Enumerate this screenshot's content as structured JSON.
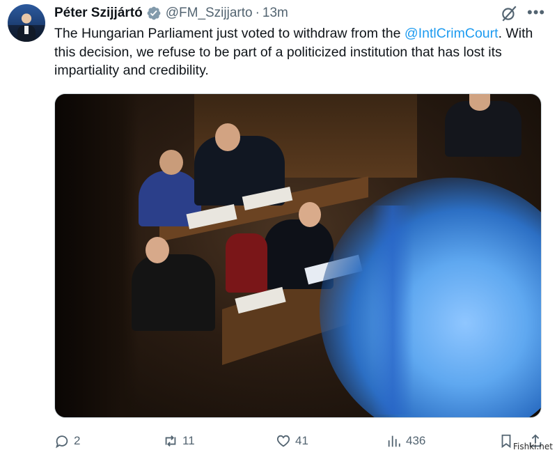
{
  "author": {
    "name": "Péter Szijjártó",
    "handle": "@FM_Szijjarto",
    "separator": "·",
    "time": "13m"
  },
  "tweet": {
    "text_part1": "The Hungarian Parliament just voted to withdraw from the ",
    "mention": "@IntlCrimCourt",
    "text_part2": ". With this decision, we refuse to be part of a politicized institution that has lost its impartiality and credibility."
  },
  "media": {
    "icon": "photo"
  },
  "actions": {
    "replies": "2",
    "reposts": "11",
    "likes": "41",
    "views": "436"
  },
  "icons": {
    "verified": "verified-badge-icon",
    "grok": "grok-icon",
    "more": "more-icon",
    "reply": "reply-icon",
    "repost": "repost-icon",
    "like": "like-icon",
    "views": "views-icon",
    "bookmark": "bookmark-icon",
    "share": "share-icon"
  },
  "colors": {
    "accent": "#1d9bf0",
    "muted": "#536471",
    "text": "#0f1419"
  },
  "watermark": "Fishki.net"
}
